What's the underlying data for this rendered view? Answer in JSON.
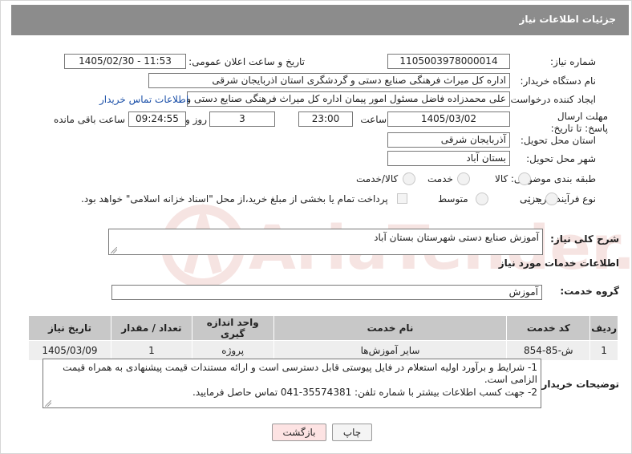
{
  "header": {
    "title": "جزئیات اطلاعات نیاز"
  },
  "fields": {
    "need_number_label": "شماره نیاز:",
    "need_number": "1105003978000014",
    "announce_label": "تاریخ و ساعت اعلان عمومی:",
    "announce_value": "1405/02/30 - 11:53",
    "buyer_org_label": "نام دستگاه خریدار:",
    "buyer_org": "اداره کل میراث فرهنگی  صنایع دستی و گردشگری استان اذربایجان شرقی",
    "requester_label": "ایجاد کننده درخواست:",
    "requester": "علی محمدزاده فاضل مسئول امور پیمان اداره کل میراث فرهنگی  صنایع دستی و",
    "contact_link": "اطلاعات تماس خریدار",
    "deadline_label": "مهلت ارسال پاسخ: تا تاریخ:",
    "deadline_date": "1405/03/02",
    "time_label": "ساعت",
    "deadline_time": "23:00",
    "days_count": "3",
    "days_label": "روز و",
    "remaining_time": "09:24:55",
    "remaining_label": "ساعت باقی مانده",
    "province_label": "استان محل تحویل:",
    "province": "آذربایجان شرقی",
    "city_label": "شهر محل تحویل:",
    "city": "بستان آباد",
    "category_label": "طبقه بندی موضوعی:",
    "category_options": [
      "کالا",
      "خدمت",
      "کالا/خدمت"
    ],
    "purchase_type_label": "نوع فرآیند خرید :",
    "purchase_options": [
      "جزیی",
      "متوسط"
    ],
    "payment_note": "پرداخت تمام یا بخشی از مبلغ خرید،از محل \"اسناد خزانه اسلامی\" خواهد بود."
  },
  "summary": {
    "label": "شرح کلی نیاز:",
    "value": "آموزش صنایع دستی شهرستان بستان آباد"
  },
  "services": {
    "section_title": "اطلاعات خدمات مورد نیاز",
    "group_label": "گروه خدمت:",
    "group_value": "آموزش",
    "columns": [
      "ردیف",
      "کد خدمت",
      "نام خدمت",
      "واحد اندازه گیری",
      "تعداد / مقدار",
      "تاریخ نیاز"
    ],
    "rows": [
      [
        "1",
        "ش-85-854",
        "سایر آموزش‌ها",
        "پروژه",
        "1",
        "1405/03/09"
      ]
    ]
  },
  "buyer_notes": {
    "label": "توضیحات خریدار:",
    "line1": "1- شرایط و برآورد اولیه استعلام در فایل پیوستی قابل دسترسی است و ارائه مستندات قیمت پیشنهادی به همراه قیمت الزامی است.",
    "line2": "2- جهت کسب اطلاعات بیشتر  با شماره تلفن: 35574381-041  تماس حاصل فرمایید."
  },
  "buttons": {
    "print": "چاپ",
    "back": "بازگشت"
  },
  "watermark": {
    "text": "AriaTender.neT"
  },
  "colors": {
    "header_bg": "#8c8c8c",
    "table_header_bg": "#c8c8c8",
    "row_bg": "#eeeeee",
    "link": "#1a4fa8",
    "back_btn_bg": "#fde3e3",
    "watermark": "#c0392b"
  }
}
